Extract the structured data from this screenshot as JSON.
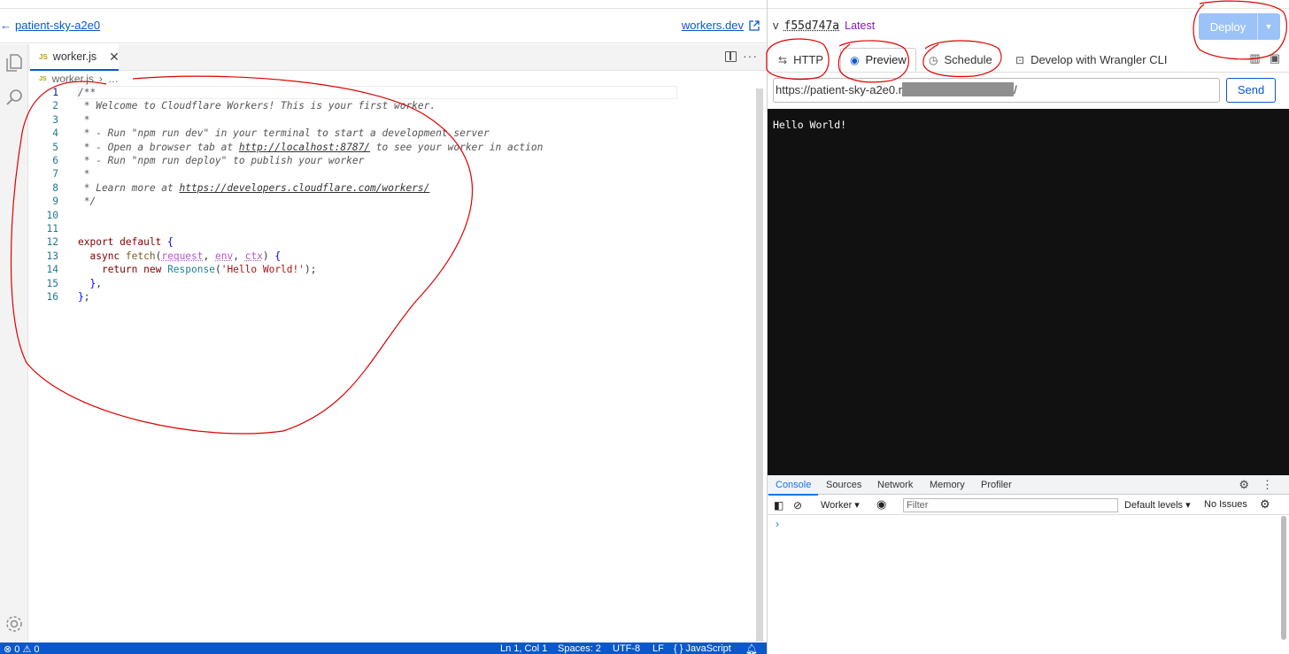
{
  "header": {
    "back_label": "patient-sky-a2e0",
    "dev_link": "workers.dev"
  },
  "editor": {
    "tab_name": "worker.js",
    "tab_badge": "JS",
    "breadcrumb_file": "worker.js",
    "breadcrumb_more": "…",
    "line_numbers": [
      "1",
      "2",
      "3",
      "4",
      "5",
      "6",
      "7",
      "8",
      "9",
      "10",
      "11",
      "12",
      "13",
      "14",
      "15",
      "16"
    ]
  },
  "status_bar": {
    "problems": "⊗ 0 ⚠ 0",
    "position": "Ln 1, Col 1",
    "spaces": "Spaces: 2",
    "encoding": "UTF-8",
    "eol": "LF",
    "language": "{ } JavaScript"
  },
  "version": {
    "prefix": "v",
    "hash": "f55d747a",
    "tag": "Latest"
  },
  "deploy": {
    "label": "Deploy"
  },
  "right_tabs": [
    {
      "label": "HTTP",
      "icon": "arrows-icon"
    },
    {
      "label": "Preview",
      "icon": "eye-icon"
    },
    {
      "label": "Schedule",
      "icon": "clock-icon"
    },
    {
      "label": "Develop with Wrangler CLI",
      "icon": "terminal-icon"
    }
  ],
  "url_bar": {
    "prefix": "https://patient-sky-a2e0.r",
    "suffix": "/"
  },
  "send_label": "Send",
  "preview_output": "Hello World!",
  "devtools": {
    "tabs": [
      "Console",
      "Sources",
      "Network",
      "Memory",
      "Profiler"
    ],
    "context": "Worker ▾",
    "filter_placeholder": "Filter",
    "levels": "Default levels ▾",
    "issues": "No Issues",
    "prompt": "›"
  },
  "colors": {
    "accent": "#0a58ca",
    "deploy_disabled": "#9cc3f8",
    "annotation": "#e00000"
  }
}
